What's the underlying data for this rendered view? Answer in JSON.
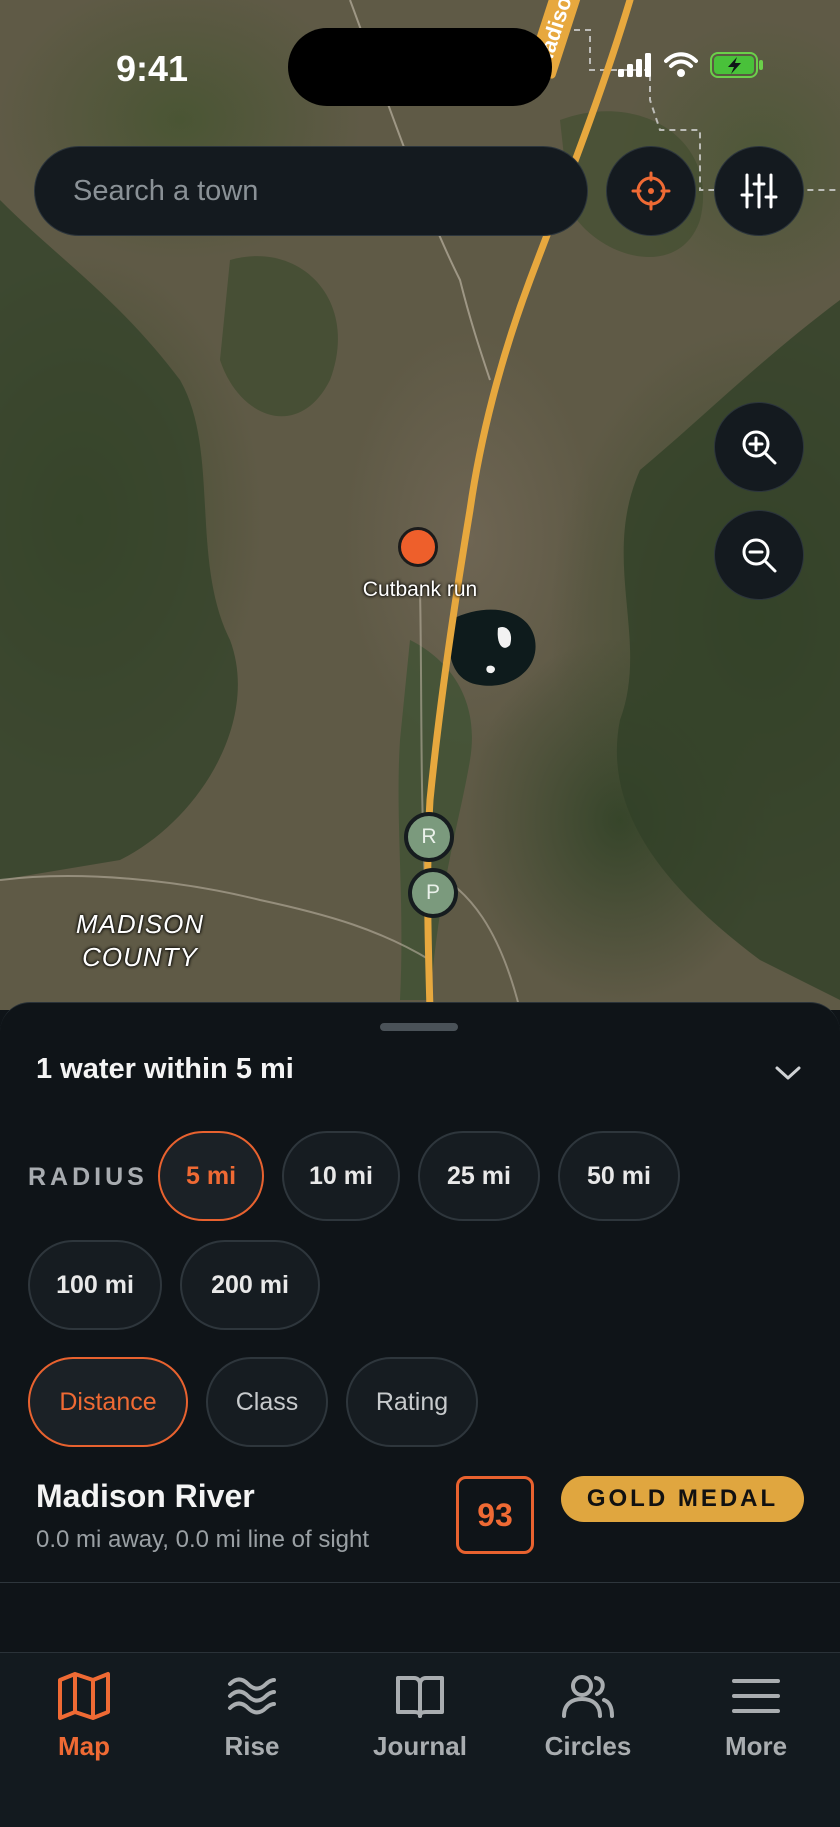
{
  "status_bar": {
    "time": "9:41"
  },
  "search": {
    "placeholder": "Search a town"
  },
  "map": {
    "river_label": "Madison River",
    "pin_label": "Cutbank run",
    "markers": [
      "R",
      "P"
    ],
    "county_label": "MADISON COUNTY",
    "icons": [
      "crosshair-icon",
      "sliders-icon",
      "zoom-in-icon",
      "zoom-out-icon"
    ]
  },
  "sheet": {
    "title": "1 water within 5 mi",
    "radius_label": "RADIUS",
    "radius_options": [
      "5 mi",
      "10 mi",
      "25 mi",
      "50 mi",
      "100 mi",
      "200 mi"
    ],
    "selected_radius": "5 mi",
    "sort_options": [
      "Distance",
      "Class",
      "Rating"
    ],
    "selected_sort": "Distance",
    "results": [
      {
        "name": "Madison River",
        "detail": "0.0 mi away, 0.0 mi line of sight",
        "score": "93",
        "badge": "GOLD MEDAL"
      }
    ]
  },
  "tabs": [
    {
      "label": "Map",
      "icon": "map-icon",
      "active": true
    },
    {
      "label": "Rise",
      "icon": "waves-icon",
      "active": false
    },
    {
      "label": "Journal",
      "icon": "book-icon",
      "active": false
    },
    {
      "label": "Circles",
      "icon": "users-icon",
      "active": false
    },
    {
      "label": "More",
      "icon": "menu-icon",
      "active": false
    }
  ],
  "colors": {
    "accent": "#ef6a34",
    "gold": "#e0a63f",
    "background": "#0f1418",
    "river": "#e7a83e",
    "marker": "#7b9a7d"
  }
}
